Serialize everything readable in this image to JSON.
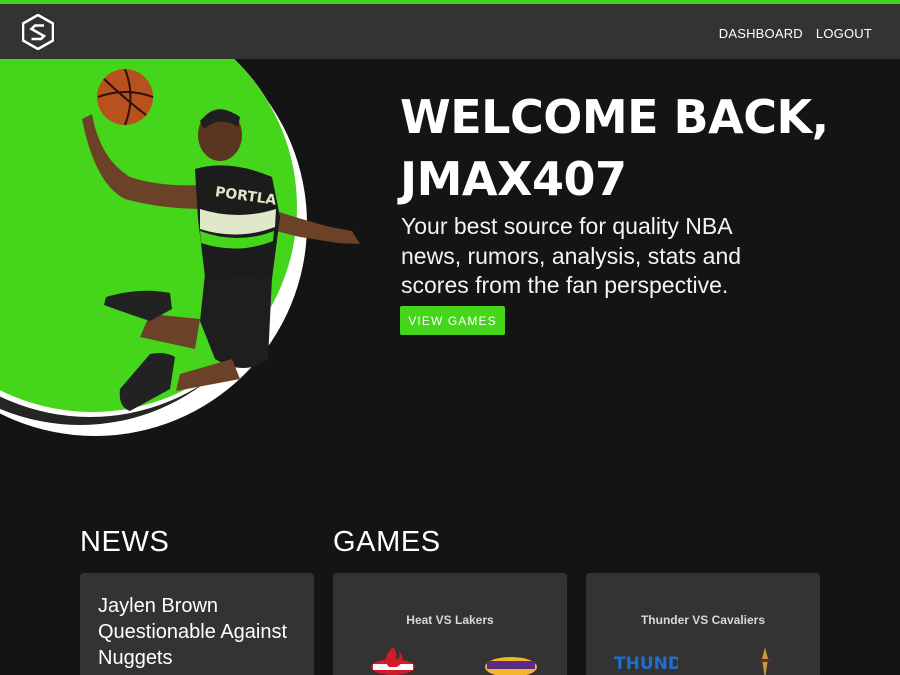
{
  "colors": {
    "accent": "#45d61b",
    "background": "#141414",
    "panel": "#333333"
  },
  "nav": {
    "logo_icon": "stacked-s-logo-icon",
    "links": [
      {
        "label": "DASHBOARD"
      },
      {
        "label": "LOGOUT"
      }
    ]
  },
  "hero": {
    "heading_line1": "WELCOME BACK,",
    "heading_line2": "JMAX407",
    "tagline": "Your best source for quality NBA news, rumors, analysis, stats and scores from the fan perspective.",
    "cta_label": "VIEW GAMES",
    "jersey_text": "PORTLA"
  },
  "news": {
    "title": "NEWS",
    "items": [
      {
        "headline": "Jaylen Brown Questionable Against Nuggets"
      }
    ]
  },
  "games": {
    "title": "GAMES",
    "items": [
      {
        "matchup": "Heat VS Lakers",
        "home_logo": "heat-logo-icon",
        "away_logo": "lakers-logo-icon"
      },
      {
        "matchup": "Thunder VS Cavaliers",
        "home_logo": "thunder-logo-icon",
        "away_logo": "cavaliers-logo-icon",
        "home_logo_text": "THUNDER"
      }
    ]
  }
}
